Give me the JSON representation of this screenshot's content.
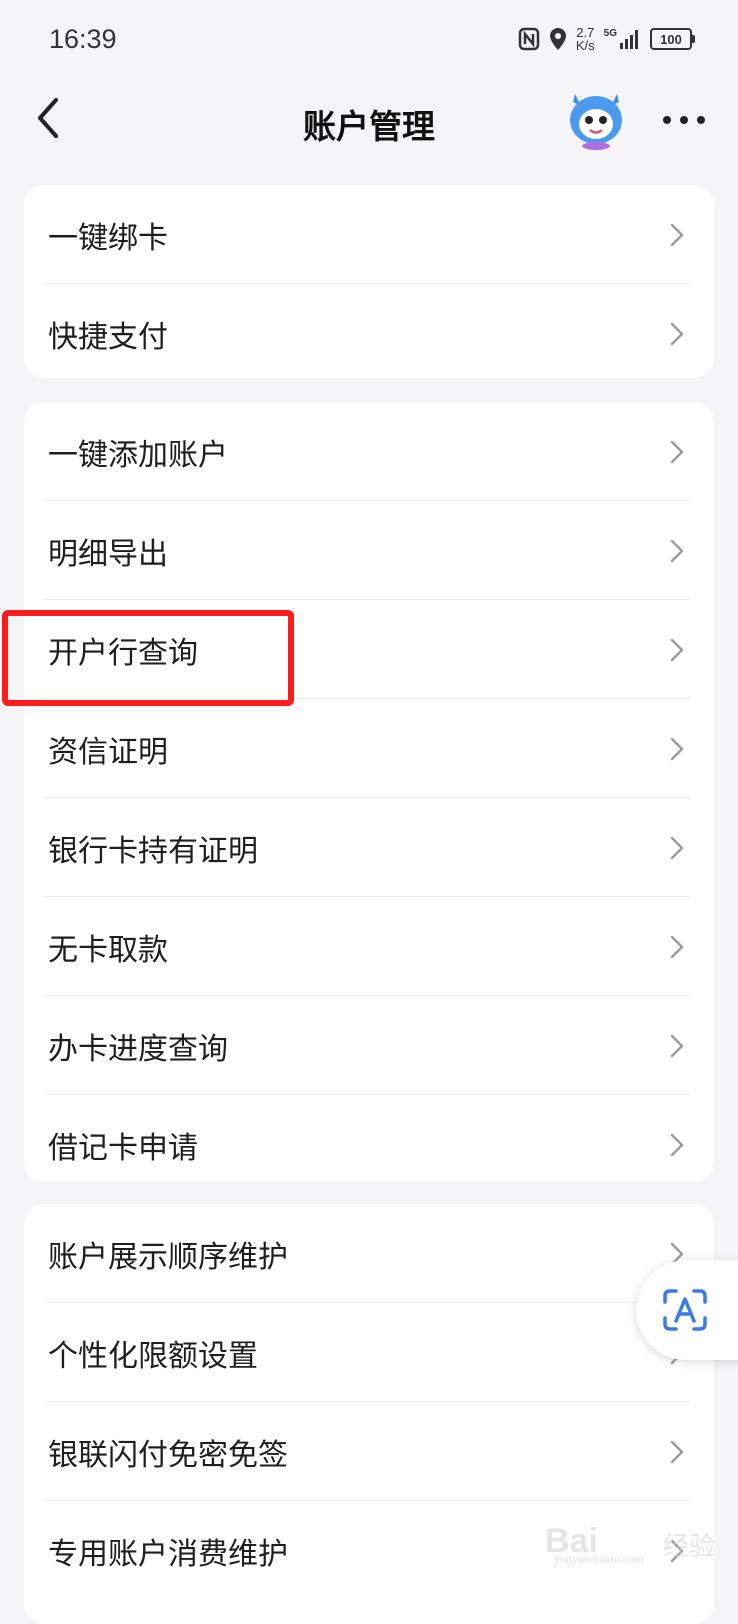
{
  "status_bar": {
    "time": "16:39",
    "speed_value": "2.7",
    "speed_unit": "K/s",
    "network": "5G",
    "battery": "100",
    "icons": [
      "nfc-icon",
      "location-icon",
      "signal-icon",
      "battery-icon"
    ]
  },
  "header": {
    "title": "账户管理",
    "icons": [
      "back-arrow-icon",
      "mascot-avatar-icon",
      "more-dots-icon"
    ]
  },
  "groups": [
    {
      "items": [
        {
          "label": "一键绑卡"
        },
        {
          "label": "快捷支付"
        }
      ]
    },
    {
      "items": [
        {
          "label": "一键添加账户"
        },
        {
          "label": "明细导出"
        },
        {
          "label": "开户行查询"
        },
        {
          "label": "资信证明"
        },
        {
          "label": "银行卡持有证明"
        },
        {
          "label": "无卡取款"
        },
        {
          "label": "办卡进度查询"
        },
        {
          "label": "借记卡申请"
        }
      ]
    },
    {
      "items": [
        {
          "label": "账户展示顺序维护"
        },
        {
          "label": "个性化限额设置"
        },
        {
          "label": "银联闪付免密免签"
        },
        {
          "label": "专用账户消费维护"
        }
      ]
    }
  ],
  "highlight": {
    "target": "开户行查询",
    "color": "#ff1c1c"
  },
  "floating_button": {
    "icon": "text-recognition-icon",
    "accent": "#3a7bea"
  },
  "watermark": {
    "brand": "Bai",
    "text": "经验",
    "url": "jingyan.baidu.com"
  },
  "colors": {
    "background": "#f5f5f7",
    "card": "#ffffff",
    "chevron": "#9a9a9a"
  }
}
